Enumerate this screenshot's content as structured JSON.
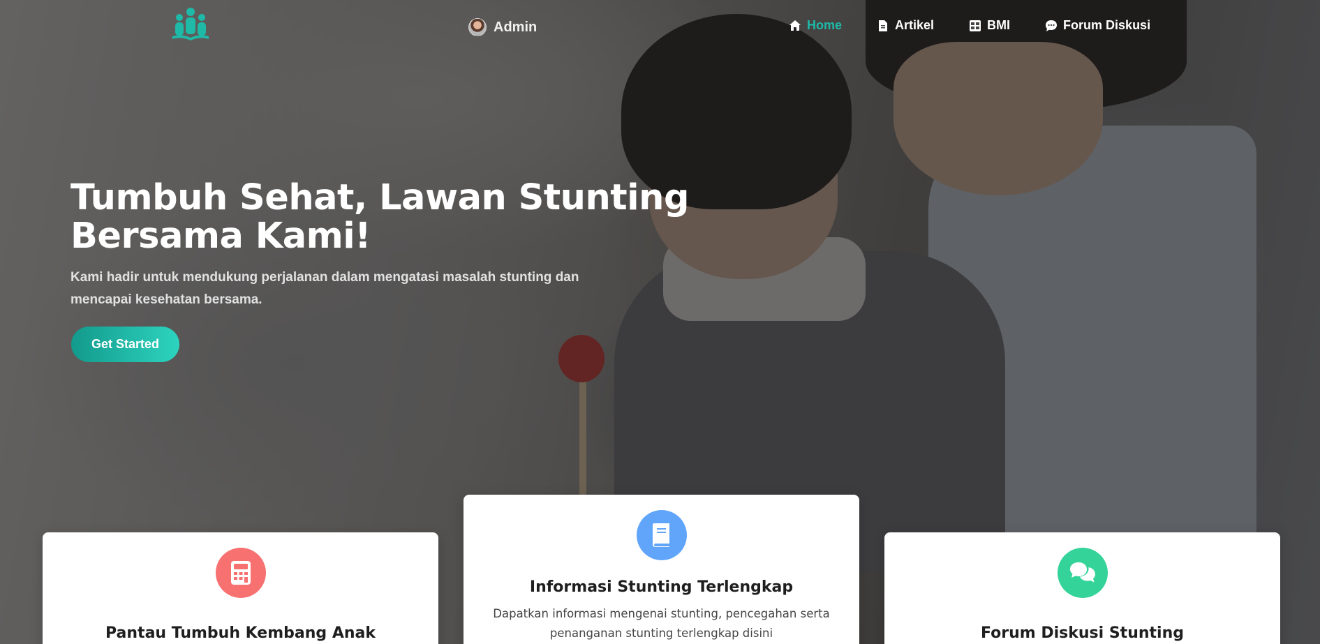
{
  "brand": {
    "logo_icon": "people-book-logo-icon",
    "accent": "#1fb9a8"
  },
  "user": {
    "name": "Admin",
    "avatar_icon": "avatar"
  },
  "nav": {
    "items": [
      {
        "label": "Home",
        "icon": "home-icon",
        "active": true
      },
      {
        "label": "Artikel",
        "icon": "document-icon",
        "active": false
      },
      {
        "label": "BMI",
        "icon": "calculator-table-icon",
        "active": false
      },
      {
        "label": "Forum Diskusi",
        "icon": "chat-bubble-icon",
        "active": false
      }
    ]
  },
  "hero": {
    "title_line1": "Tumbuh Sehat, Lawan Stunting",
    "title_line2": "Bersama Kami!",
    "subtitle_line1": "Kami hadir untuk mendukung perjalanan dalam mengatasi masalah stunting dan",
    "subtitle_line2": "mencapai kesehatan bersama.",
    "cta_label": "Get Started"
  },
  "cards": [
    {
      "title": "Pantau Tumbuh Kembang Anak",
      "icon": "calculator-icon",
      "icon_color": "#f87171",
      "desc_line1": "",
      "desc_line2": ""
    },
    {
      "title": "Informasi Stunting Terlengkap",
      "icon": "book-icon",
      "icon_color": "#60a5fa",
      "desc_line1": "Dapatkan informasi mengenai stunting, pencegahan serta",
      "desc_line2": "penanganan stunting terlengkap disini"
    },
    {
      "title": "Forum Diskusi Stunting",
      "icon": "chat-icon",
      "icon_color": "#34d399",
      "desc_line1": "",
      "desc_line2": ""
    }
  ]
}
